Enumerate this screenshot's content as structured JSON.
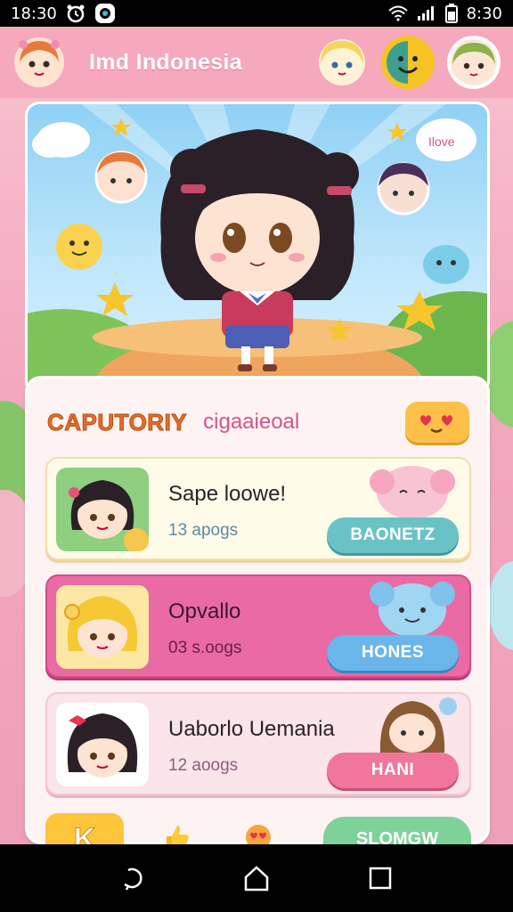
{
  "status_bar": {
    "time_left": "18:30",
    "time_right": "8:30"
  },
  "header": {
    "title": "Imd Indonesia"
  },
  "hero": {
    "speech_bubble_text": "Ilove"
  },
  "category": {
    "title": "CAPUTORIY",
    "subtitle": "cigaaieoal"
  },
  "rows": [
    {
      "title": "Sape loowe!",
      "count": "13 apogs",
      "button": "BAONETZ"
    },
    {
      "title": "Opvallo",
      "count": "03 s.oogs",
      "button": "HONES"
    },
    {
      "title": "Uaborlo Uemania",
      "count": "12 aoogs",
      "button": "HANI"
    }
  ],
  "footer": {
    "k_label": "K",
    "action_label": "SLOMGW"
  },
  "colors": {
    "header": "#f6a8bd",
    "card": "#fdf3f3",
    "row_highlight": "#ea6aa4",
    "accent_yellow": "#ffc53a"
  },
  "icons": [
    "wifi-icon",
    "signal-icon",
    "battery-icon",
    "back-icon",
    "home-icon",
    "recents-icon"
  ]
}
